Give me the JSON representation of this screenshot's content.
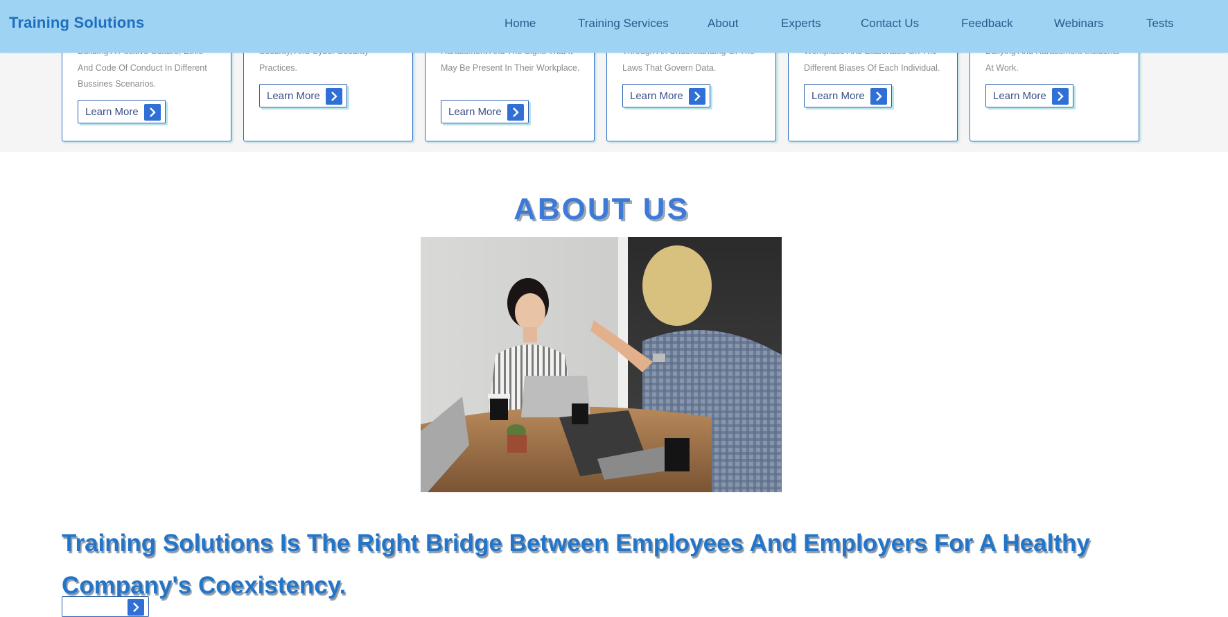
{
  "header": {
    "brand": "Training Solutions",
    "nav": [
      "Home",
      "Training Services",
      "About",
      "Experts",
      "Contact Us",
      "Feedback",
      "Webinars",
      "Tests"
    ]
  },
  "services": {
    "cards": [
      {
        "text": "Building A Positive Culture, Ethic And Code Of Conduct In Different Bussines Scenarios.",
        "button": "Learn More"
      },
      {
        "text": "Security, And Cyber Security Practices.",
        "button": "Learn More"
      },
      {
        "text": "Harassment And The Signs That It May Be Present In Their Workplace.",
        "button": "Learn More"
      },
      {
        "text": "Through An Understanding Of The Laws That Govern Data.",
        "button": "Learn More"
      },
      {
        "text": "Workplace And Elaborates On The Different Biases Of Each Individual.",
        "button": "Learn More"
      },
      {
        "text": "Bullying And Harassment Incidents At Work.",
        "button": "Learn More"
      }
    ]
  },
  "about": {
    "title": "ABOUT US",
    "heading": "Training Solutions Is The Right Bridge Between Employees And Employers For A Healthy Company's Coexistency."
  },
  "colors": {
    "header_bg": "#9fd3f3",
    "brand": "#1e6fbf",
    "accent": "#2f6fd6",
    "section_bg": "#f5f5f5"
  },
  "icons": {
    "learn_more_arrow": "chevron-right-icon"
  }
}
